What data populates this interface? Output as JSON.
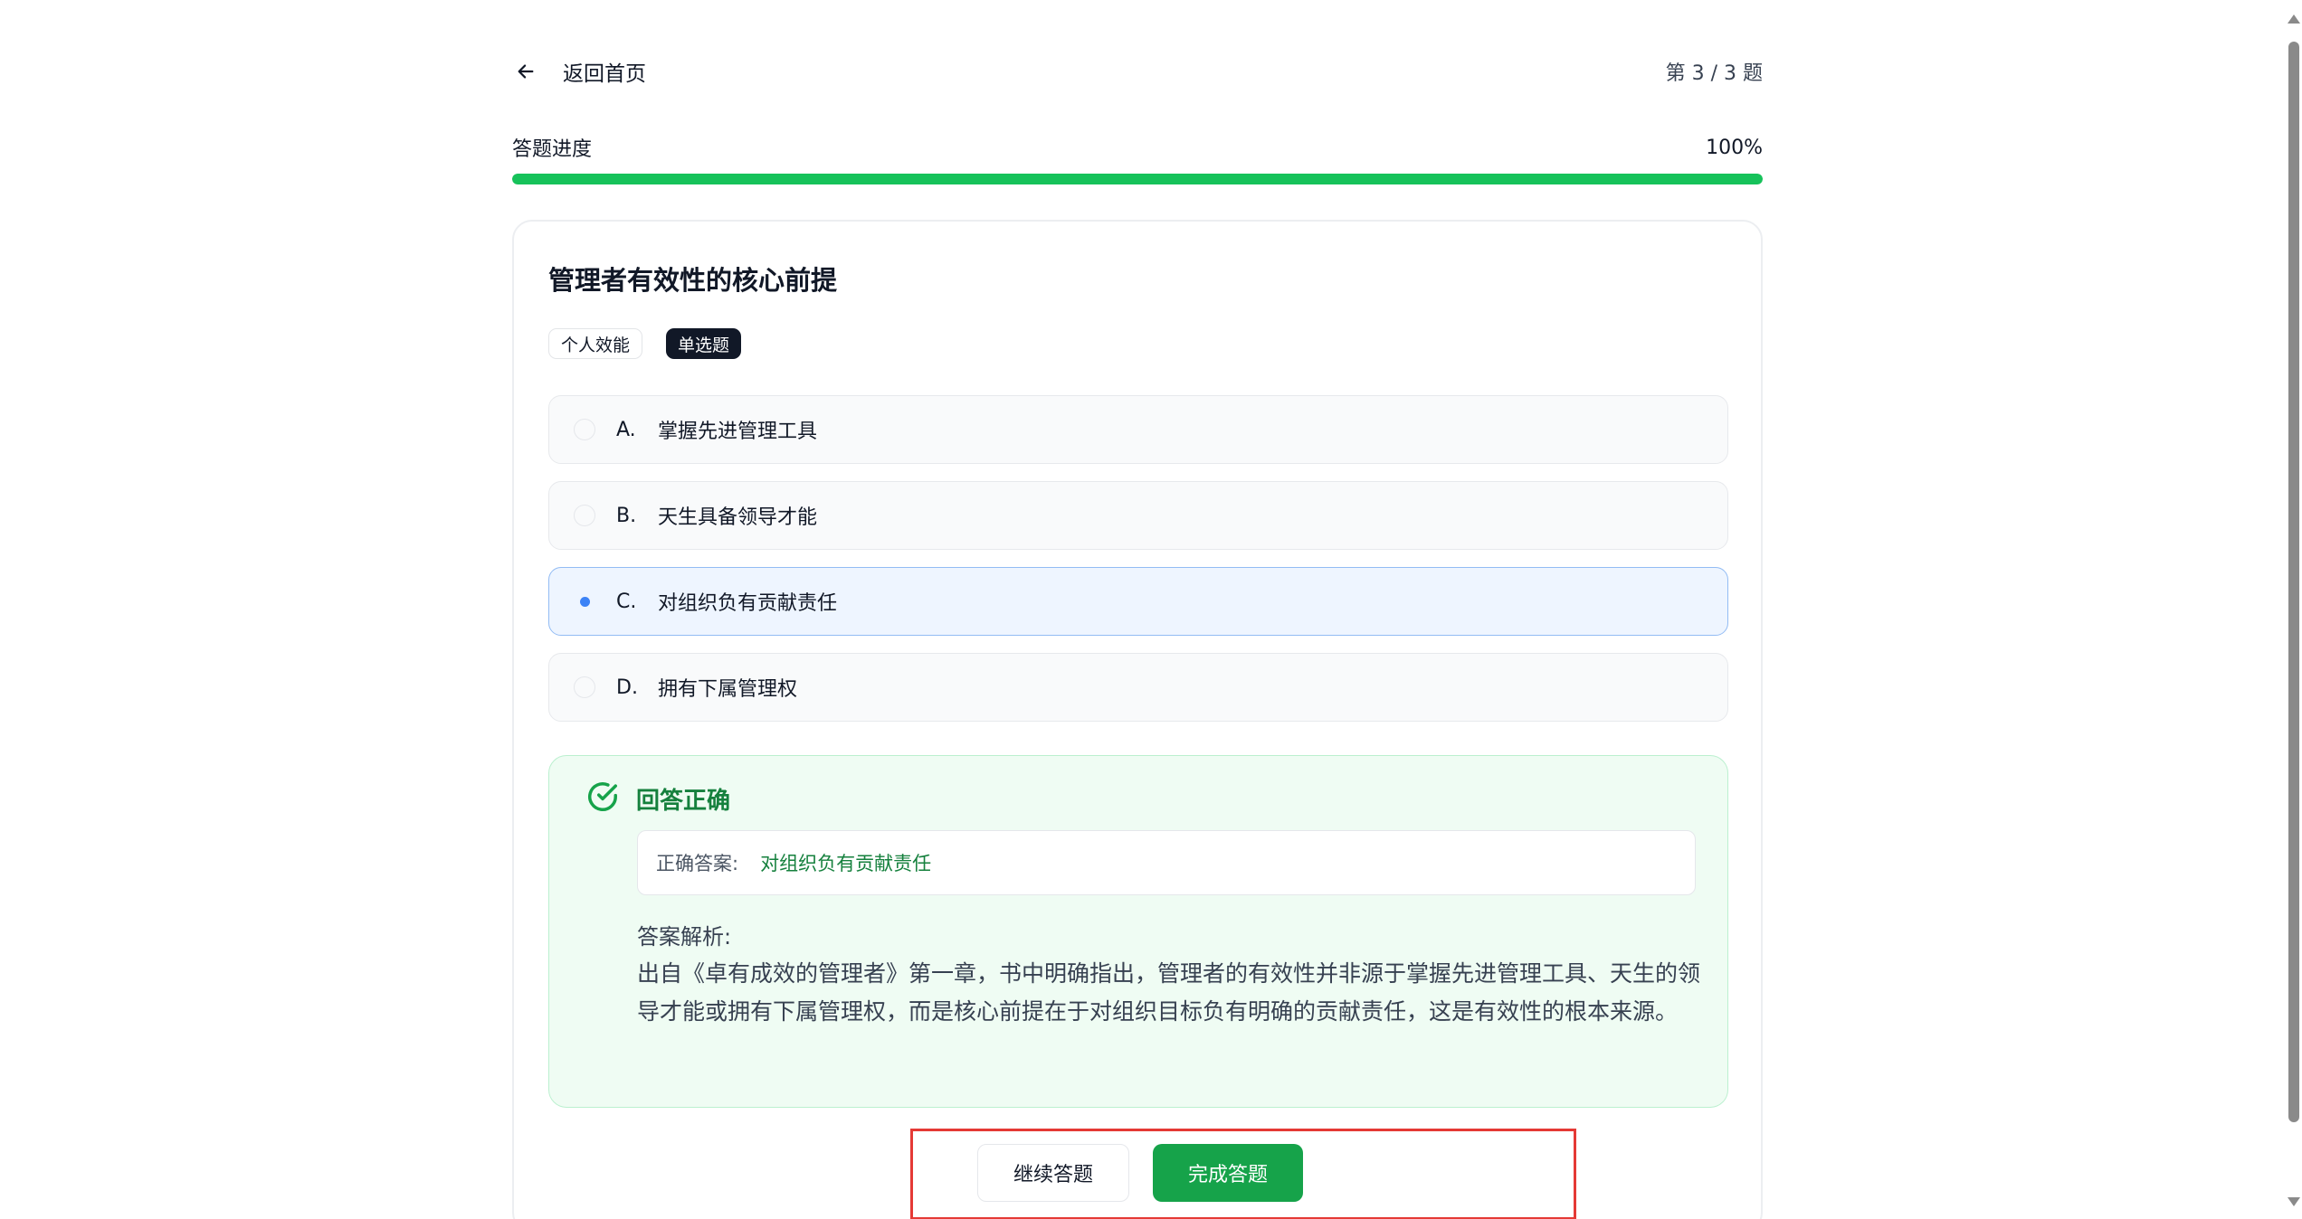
{
  "nav": {
    "back_label": "返回首页",
    "counter": "第 3 / 3 题"
  },
  "progress": {
    "label": "答题进度",
    "percent_text": "100%",
    "value": 100,
    "color": "#16c25a"
  },
  "question": {
    "title": "管理者有效性的核心前提",
    "tags": [
      "个人效能",
      "单选题"
    ],
    "options": [
      {
        "letter": "A.",
        "text": "掌握先进管理工具",
        "selected": false
      },
      {
        "letter": "B.",
        "text": "天生具备领导才能",
        "selected": false
      },
      {
        "letter": "C.",
        "text": "对组织负有贡献责任",
        "selected": true
      },
      {
        "letter": "D.",
        "text": "拥有下属管理权",
        "selected": false
      }
    ]
  },
  "result": {
    "status": "回答正确",
    "answer_label": "正确答案:",
    "answer_value": "对组织负有贡献责任",
    "explain_label": "答案解析:",
    "explain_text": "出自《卓有成效的管理者》第一章，书中明确指出，管理者的有效性并非源于掌握先进管理工具、天生的领导才能或拥有下属管理权，而是核心前提在于对组织目标负有明确的贡献责任，这是有效性的根本来源。"
  },
  "actions": {
    "continue_label": "继续答题",
    "finish_label": "完成答题"
  },
  "colors": {
    "success": "#16a34a",
    "selected_border": "#93bcf4",
    "highlight": "#e53935"
  }
}
